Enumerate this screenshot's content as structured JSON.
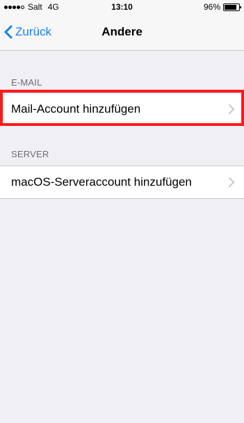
{
  "status_bar": {
    "carrier": "Salt",
    "network": "4G",
    "time": "13:10",
    "battery": "96%",
    "battery_level": 0.96
  },
  "nav": {
    "back_label": "Zurück",
    "title": "Andere"
  },
  "sections": [
    {
      "header": "E-MAIL",
      "rows": [
        {
          "label": "Mail-Account hinzufügen"
        }
      ]
    },
    {
      "header": "SERVER",
      "rows": [
        {
          "label": "macOS-Serveraccount hinzufügen"
        }
      ]
    }
  ],
  "icons": {
    "back": "chevron-left-icon",
    "disclosure": "chevron-right-icon"
  },
  "colors": {
    "accent": "#147efb",
    "highlight": "#ff1a1a",
    "background": "#efeff4"
  }
}
